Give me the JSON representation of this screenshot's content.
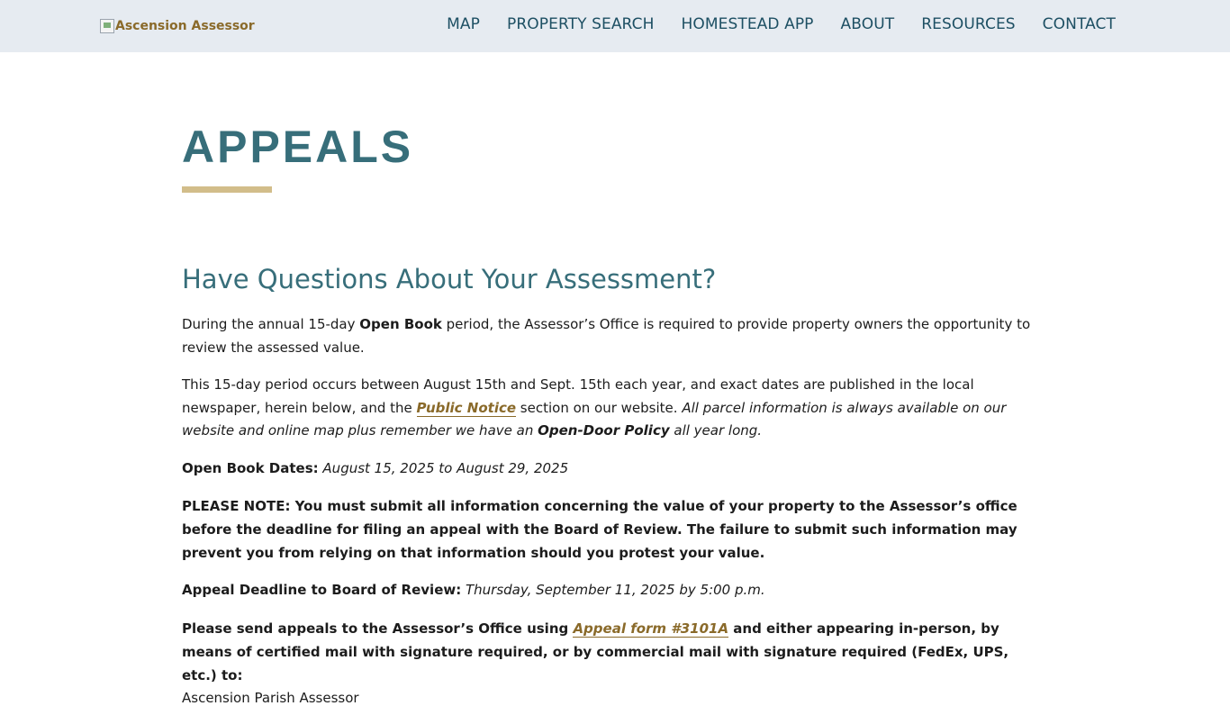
{
  "header": {
    "logo_alt": "Ascension Assessor",
    "nav": [
      "MAP",
      "PROPERTY SEARCH",
      "HOMESTEAD APP",
      "ABOUT",
      "RESOURCES",
      "CONTACT"
    ]
  },
  "page": {
    "title": "APPEALS",
    "section_heading": "Have Questions About Your Assessment?",
    "p1": {
      "a": "During the annual 15-day ",
      "b": "Open Book",
      "c": " period, the Assessor’s Office is required to provide property owners the opportunity to review the assessed value."
    },
    "p2": {
      "a": "This 15-day period occurs between August 15th and Sept. 15th each year, and exact dates are published in the local newspaper, herein below, and the ",
      "link": "Public Notice",
      "b": " section on our website.  ",
      "c": "All parcel information is always available on our website and online map plus remember we have an ",
      "d": "Open-Door Policy",
      "e": " all year long."
    },
    "open_book": {
      "label": "Open Book Dates:",
      "value": " August 15, 2025 to August 29, 2025"
    },
    "note": "PLEASE NOTE: You must submit all information concerning the value of your property to the Assessor’s office before the deadline for filing an appeal with the Board of Review. The failure to submit such information may prevent you from relying on that information should you protest your value.",
    "deadline": {
      "label": "Appeal Deadline to Board of Review:",
      "value": " Thursday, September 11, 2025 by 5:00 p.m."
    },
    "send": {
      "a": "Please send appeals to the Assessor’s Office using ",
      "link": "Appeal form #3101A",
      "b": " and either appearing in-person, by means of certified mail with signature required, or by commercial mail with signature required (FedEx, UPS, etc.) to:"
    },
    "address_line1": "Ascension Parish Assessor"
  },
  "colors": {
    "header_bg": "#e6ebf1",
    "nav_text": "#1d4f63",
    "title": "#376e7a",
    "accent_rule": "#d2bd8a",
    "link": "#8a6a2a"
  }
}
